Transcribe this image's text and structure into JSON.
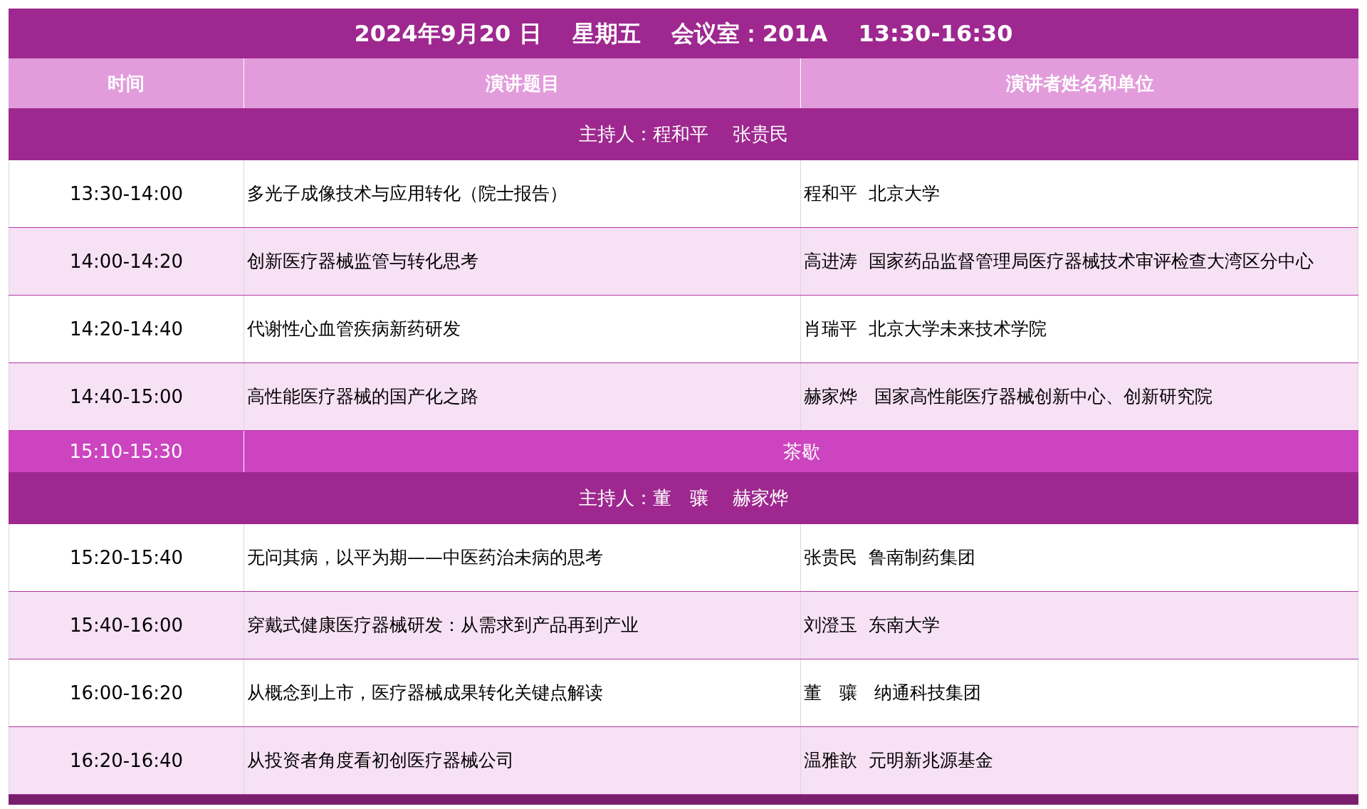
{
  "title": "2024年9月20 日　 星期五　 会议室：201A　 13:30-16:30",
  "columns": [
    "时间",
    "演讲题目",
    "演讲者姓名和单位"
  ],
  "rows": [
    {
      "kind": "host",
      "text": "主持人：程和平　 张贵民"
    },
    {
      "kind": "talk",
      "time": "13:30-14:00",
      "topic": "多光子成像技术与应用转化（院士报告）",
      "speaker": "程和平  北京大学"
    },
    {
      "kind": "talk",
      "time": "14:00-14:20",
      "topic": "创新医疗器械监管与转化思考",
      "speaker": "高进涛  国家药品监督管理局医疗器械技术审评检查大湾区分中心"
    },
    {
      "kind": "talk",
      "time": "14:20-14:40",
      "topic": "代谢性心血管疾病新药研发",
      "speaker": "肖瑞平  北京大学未来技术学院"
    },
    {
      "kind": "talk",
      "time": "14:40-15:00",
      "topic": "高性能医疗器械的国产化之路",
      "speaker": "赫家烨   国家高性能医疗器械创新中心、创新研究院"
    },
    {
      "kind": "break",
      "time": "15:10-15:30",
      "text": "茶歇"
    },
    {
      "kind": "host",
      "text": "主持人：董　骧　 赫家烨"
    },
    {
      "kind": "talk",
      "time": "15:20-15:40",
      "topic": "无问其病，以平为期——中医药治未病的思考",
      "speaker": "张贵民  鲁南制药集团"
    },
    {
      "kind": "talk",
      "time": "15:40-16:00",
      "topic": "穿戴式健康医疗器械研发：从需求到产品再到产业",
      "speaker": "刘澄玉  东南大学"
    },
    {
      "kind": "talk",
      "time": "16:00-16:20",
      "topic": "从概念到上市，医疗器械成果转化关键点解读",
      "speaker": "董　骧   纳通科技集团"
    },
    {
      "kind": "talk",
      "time": "16:20-16:40",
      "topic": "从投资者角度看初创医疗器械公司",
      "speaker": "温雅歆  元明新兆源基金"
    }
  ]
}
